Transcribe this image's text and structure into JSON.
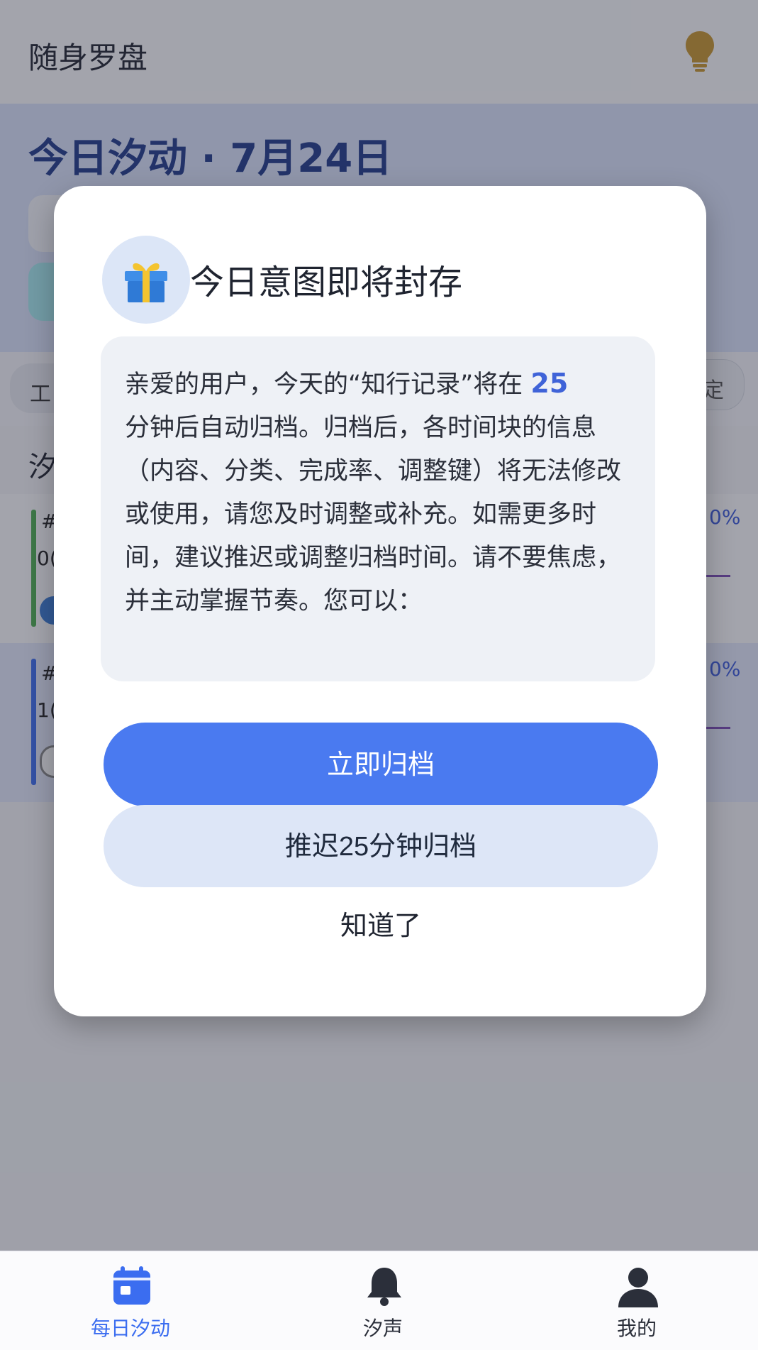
{
  "app": {
    "title": "随身罗盘"
  },
  "hero": {
    "title": "今日汐动 · 7月24日"
  },
  "filters": {
    "left_label": "工",
    "right_label": "定"
  },
  "section": {
    "heading": "汐",
    "link": "]"
  },
  "cards": [
    {
      "tag": "#",
      "time": "0(",
      "pct": "0%"
    },
    {
      "tag": "#",
      "time": "1(",
      "pct": "0%"
    }
  ],
  "dialog": {
    "icon": "gift-icon",
    "title": "今日意图即将封存",
    "message_before": "亲爱的用户，今天的“知行记录”将在",
    "minutes": "25",
    "message_after": "分钟后自动归档。归档后，各时间块的信息（内容、分类、完成率、调整键）将无法修改或使用，请您及时调整或补充。如需更多时间，建议推迟或调整归档时间。请不要焦虑，并主动掌握节奏。您可以：",
    "primary_button": "立即归档",
    "secondary_button": "推迟25分钟归档",
    "dismiss_button": "知道了"
  },
  "bottom_nav": [
    {
      "label": "每日汐动",
      "icon": "calendar-icon",
      "active": true
    },
    {
      "label": "汐声",
      "icon": "bell-icon",
      "active": false
    },
    {
      "label": "我的",
      "icon": "user-icon",
      "active": false
    }
  ],
  "colors": {
    "accent": "#4a7af0",
    "accent_light": "#dde6f7",
    "hero_title": "#1f3a8a",
    "bulb": "#c8962e",
    "nav_active": "#3b6df0",
    "nav_inactive": "#2b2f3a"
  }
}
